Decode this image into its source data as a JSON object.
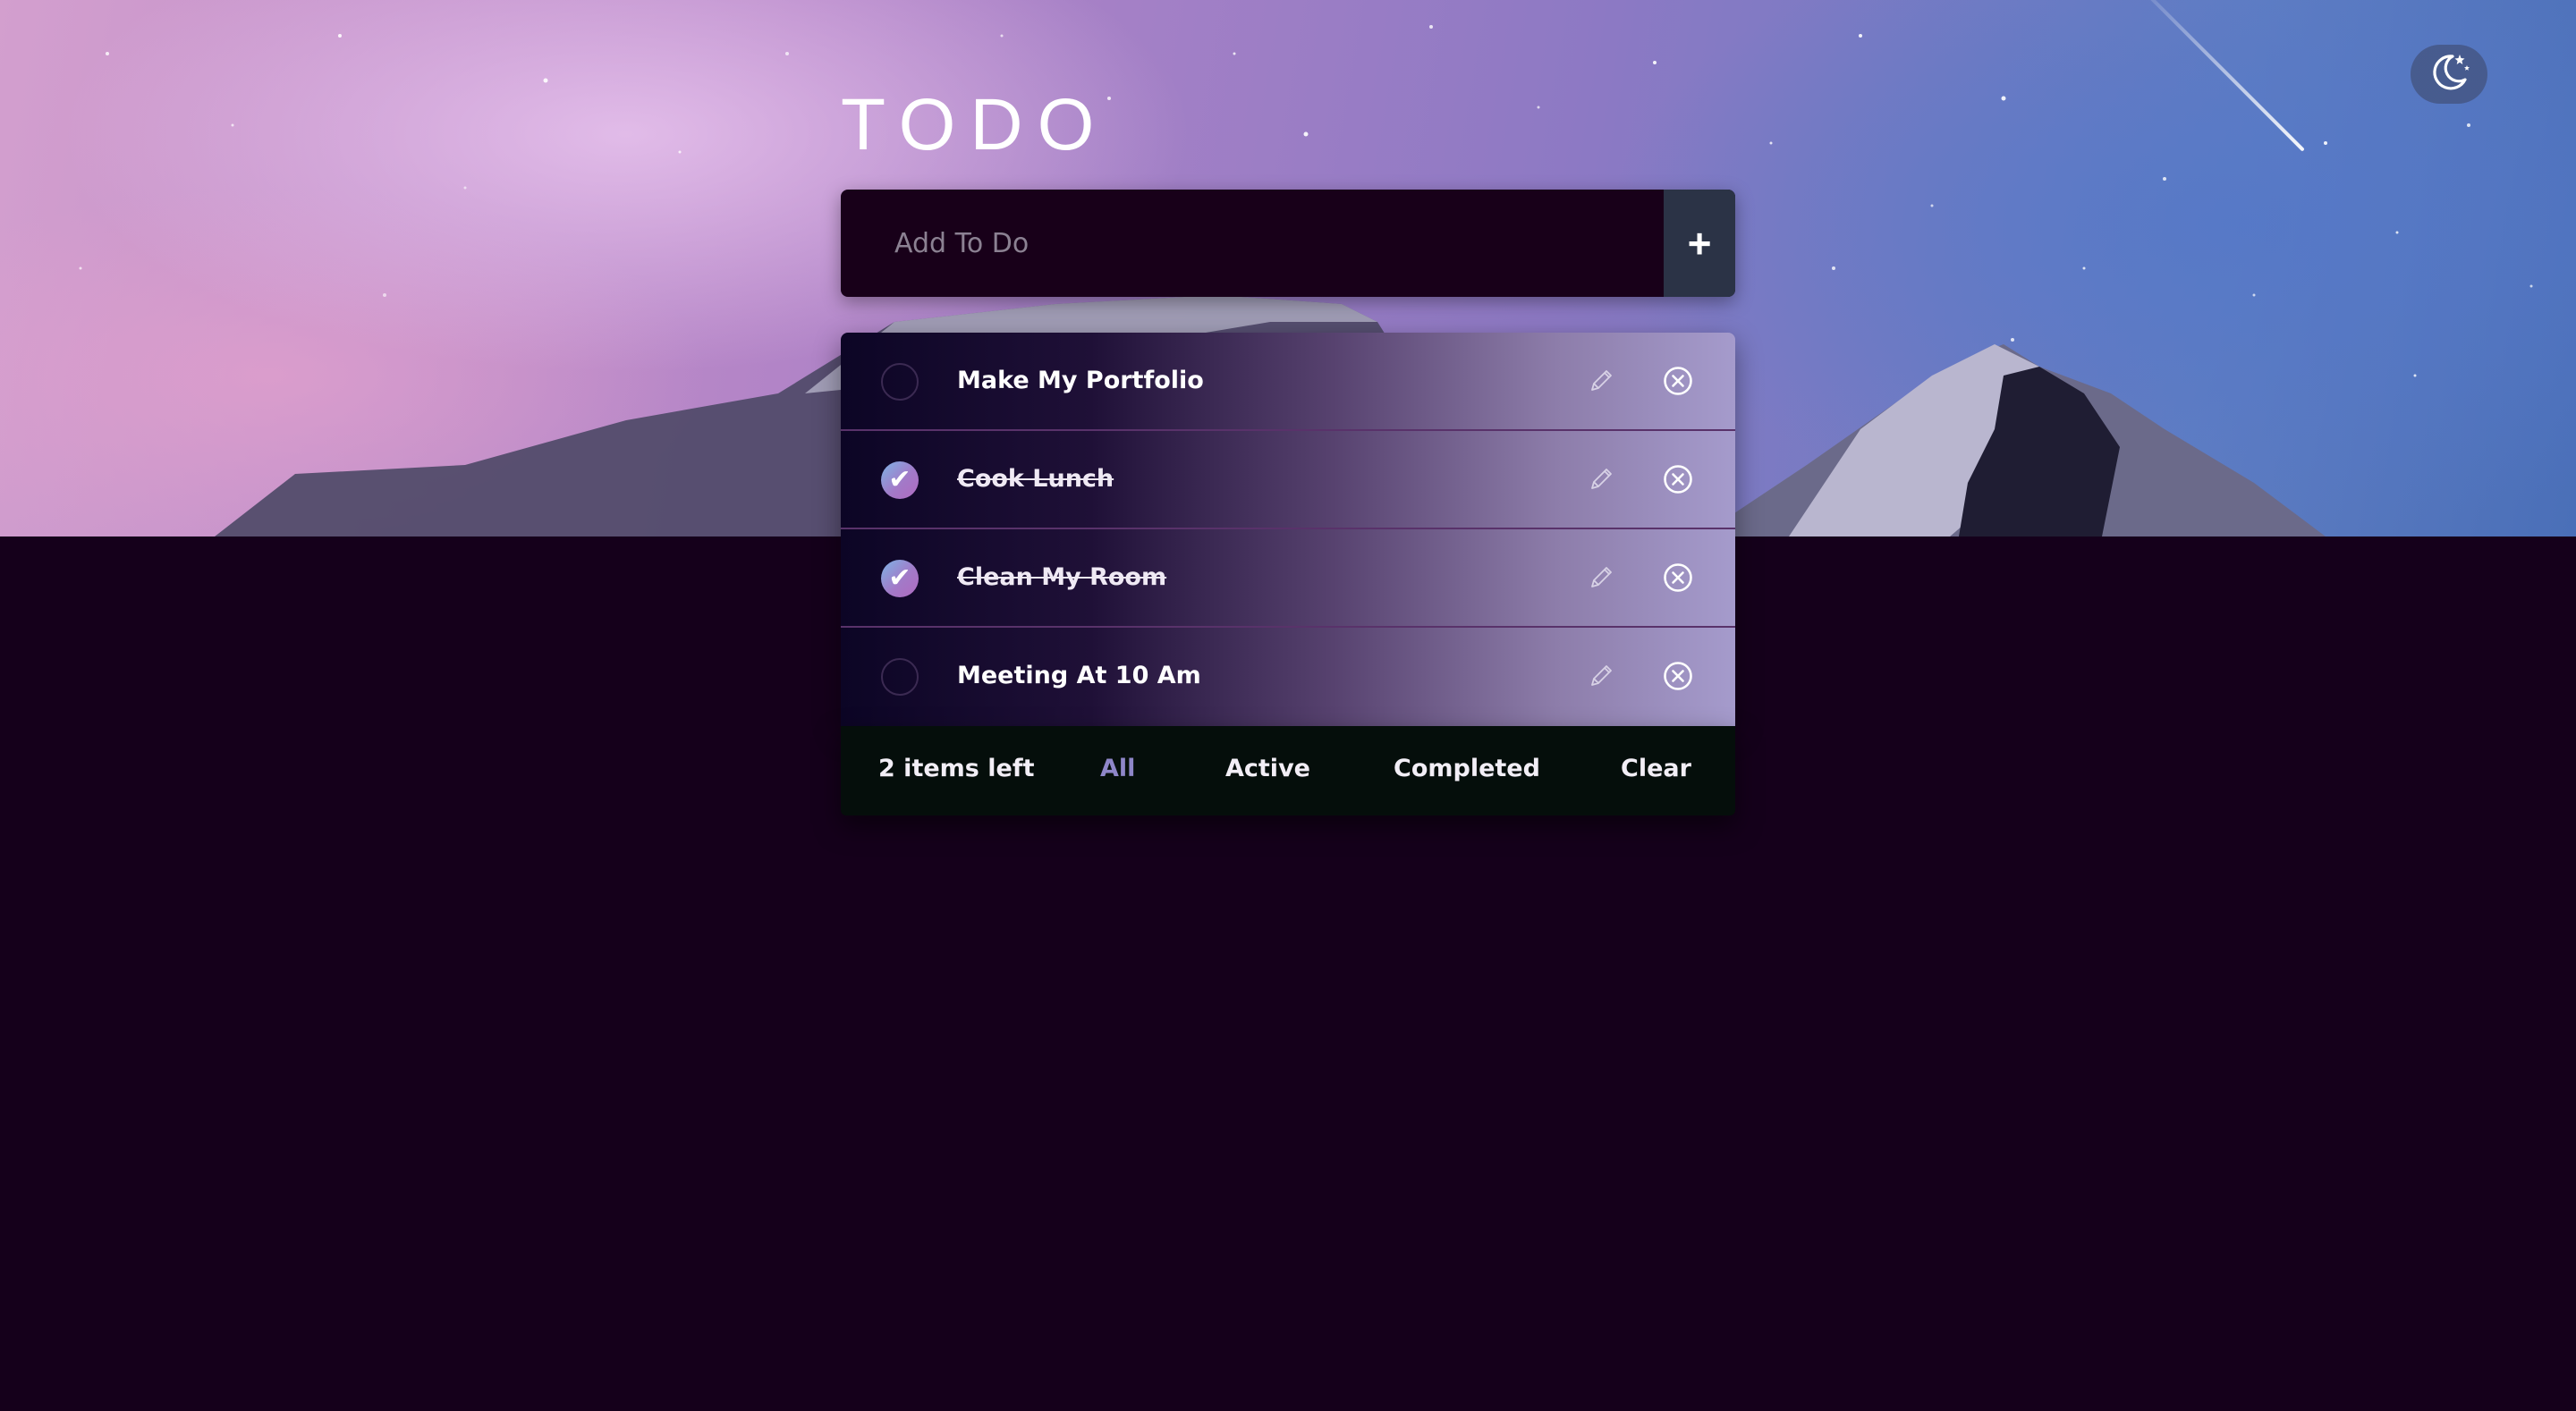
{
  "app": {
    "title": "TODO"
  },
  "theme_toggle": {
    "icon": "moon-stars-icon"
  },
  "add_todo": {
    "placeholder": "Add To Do",
    "value": "",
    "button_label": "+"
  },
  "todos": [
    {
      "text": "Make My Portfolio",
      "completed": false
    },
    {
      "text": "Cook Lunch",
      "completed": true
    },
    {
      "text": "Clean My Room",
      "completed": true
    },
    {
      "text": "Meeting At 10 Am",
      "completed": false
    }
  ],
  "footer": {
    "items_left": "2 items left",
    "filter_all": "All",
    "filter_active": "Active",
    "filter_completed": "Completed",
    "clear_label": "Clear",
    "selected_filter": "All"
  },
  "icons": {
    "check": "check-icon",
    "edit": "pencil-icon",
    "delete": "close-circle-icon"
  },
  "colors": {
    "page_background": "#15001b",
    "accent": "#8e86c8",
    "input_background": "#180019",
    "add_button_background": "#2b3346",
    "footer_background": "#050e0b"
  }
}
